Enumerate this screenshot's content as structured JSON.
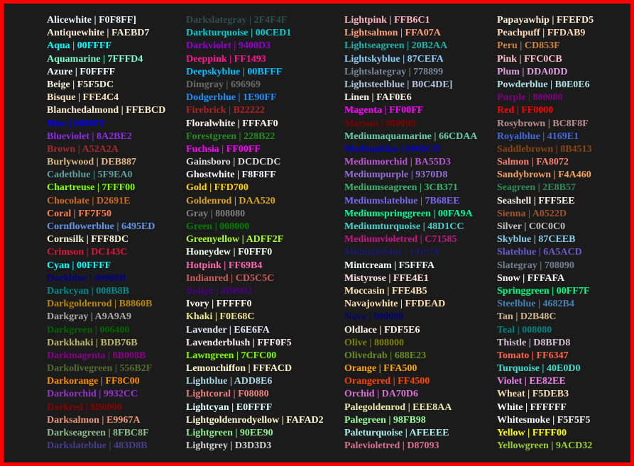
{
  "columns": [
    [
      {
        "label": "Alicewhite | F0F8FF]",
        "color": "#F0F8FF"
      },
      {
        "label": "Antiquewhite | FAEBD7",
        "color": "#FAEBD7"
      },
      {
        "label": "Aqua | 00FFFF",
        "color": "#00FFFF",
        "bold": true
      },
      {
        "label": "Aquamarine | 7FFFD4",
        "color": "#7FFFD4"
      },
      {
        "label": "Azure | F0FFFF",
        "color": "#F0FFFF"
      },
      {
        "label": "Beige | F5F5DC",
        "color": "#F5F5DC"
      },
      {
        "label": "Bisque | FFE4C4",
        "color": "#FFE4C4"
      },
      {
        "label": "Blanchedalmond | FFEBCD",
        "color": "#FFEBCD"
      },
      {
        "label": "Blue | 0000FF",
        "color": "#0000FF",
        "bold": true
      },
      {
        "label": "Blueviolet | 8A2BE2",
        "color": "#8A2BE2"
      },
      {
        "label": "Brown | A52A2A",
        "color": "#A52A2A"
      },
      {
        "label": "Burlywood | DEB887",
        "color": "#DEB887"
      },
      {
        "label": "Cadetblue | 5F9EA0",
        "color": "#5F9EA0"
      },
      {
        "label": "Chartreuse | 7FFF00",
        "color": "#7FFF00"
      },
      {
        "label": "Chocolate | D2691E",
        "color": "#D2691E"
      },
      {
        "label": "Coral | FF7F50",
        "color": "#FF7F50"
      },
      {
        "label": "Cornflowerblue | 6495ED",
        "color": "#6495ED"
      },
      {
        "label": "Cornsilk | FFF8DC",
        "color": "#FFF8DC"
      },
      {
        "label": "Crimson | DC143C",
        "color": "#DC143C"
      },
      {
        "label": "Cyan | 00FFFF",
        "color": "#00FFFF",
        "bold": true
      },
      {
        "label": "Darkblue | 00008B",
        "color": "#00008B"
      },
      {
        "label": "Darkcyan | 008B8B",
        "color": "#008B8B"
      },
      {
        "label": "Darkgoldenrod | B8860B",
        "color": "#B8860B"
      },
      {
        "label": "Darkgray | A9A9A9",
        "color": "#A9A9A9"
      },
      {
        "label": "Darkgreen | 006400",
        "color": "#006400"
      },
      {
        "label": "Darkkhaki | BDB76B",
        "color": "#BDB76B"
      },
      {
        "label": "Darkmagenta | 8B008B",
        "color": "#8B008B"
      },
      {
        "label": "Darkolivegreen | 556B2F",
        "color": "#556B2F"
      },
      {
        "label": "Darkorange | FF8C00",
        "color": "#FF8C00"
      },
      {
        "label": "Darkorchid | 9932CC",
        "color": "#9932CC"
      },
      {
        "label": "Darkred | 8B0000",
        "color": "#8B0000"
      },
      {
        "label": "Darksalmon | E9967A",
        "color": "#E9967A"
      },
      {
        "label": "Darkseagreen | 8FBC8F",
        "color": "#8FBC8F"
      },
      {
        "label": "Darkslateblue | 483D8B",
        "color": "#483D8B"
      }
    ],
    [
      {
        "label": "Darkslategray | 2F4F4F",
        "color": "#2F4F4F"
      },
      {
        "label": "Darkturquoise | 00CED1",
        "color": "#00CED1"
      },
      {
        "label": "Darkviolet | 9400D3",
        "color": "#9400D3"
      },
      {
        "label": "Deeppink | FF1493",
        "color": "#FF1493"
      },
      {
        "label": "Deepskyblue | 00BFFF",
        "color": "#00BFFF"
      },
      {
        "label": "Dimgray | 696969",
        "color": "#696969"
      },
      {
        "label": "Dodgerblue | 1E90FF",
        "color": "#1E90FF"
      },
      {
        "label": "Firebrick | B22222",
        "color": "#B22222"
      },
      {
        "label": "Floralwhite | FFFAF0",
        "color": "#FFFAF0"
      },
      {
        "label": "Forestgreen | 228B22",
        "color": "#228B22"
      },
      {
        "label": "Fuchsia | FF00FF",
        "color": "#FF00FF",
        "bold": true
      },
      {
        "label": "Gainsboro | DCDCDC",
        "color": "#DCDCDC"
      },
      {
        "label": "Ghostwhite | F8F8FF",
        "color": "#F8F8FF"
      },
      {
        "label": "Gold | FFD700",
        "color": "#FFD700"
      },
      {
        "label": "Goldenrod | DAA520",
        "color": "#DAA520"
      },
      {
        "label": "Gray | 808080",
        "color": "#808080"
      },
      {
        "label": "Green | 008000",
        "color": "#008000"
      },
      {
        "label": "Greenyellow | ADFF2F",
        "color": "#ADFF2F"
      },
      {
        "label": "Honeydew | F0FFF0",
        "color": "#F0FFF0"
      },
      {
        "label": "Hotpink | FF69B4",
        "color": "#FF69B4"
      },
      {
        "label": "Indianred | CD5C5C",
        "color": "#CD5C5C"
      },
      {
        "label": "Indigo | 4B0082",
        "color": "#4B0082"
      },
      {
        "label": "Ivory | FFFFF0",
        "color": "#FFFFF0"
      },
      {
        "label": "Khaki | F0E68C",
        "color": "#F0E68C"
      },
      {
        "label": "Lavender | E6E6FA",
        "color": "#E6E6FA"
      },
      {
        "label": "Lavenderblush | FFF0F5",
        "color": "#FFF0F5"
      },
      {
        "label": "Lawngreen | 7CFC00",
        "color": "#7CFC00"
      },
      {
        "label": "Lemonchiffon | FFFACD",
        "color": "#FFFACD"
      },
      {
        "label": "Lightblue | ADD8E6",
        "color": "#ADD8E6"
      },
      {
        "label": "Lightcoral | F08080",
        "color": "#F08080"
      },
      {
        "label": "Lightcyan | E0FFFF",
        "color": "#E0FFFF"
      },
      {
        "label": "Lightgoldenrodyellow | FAFAD2",
        "color": "#FAFAD2"
      },
      {
        "label": "Lightgreen | 90EE90",
        "color": "#90EE90"
      },
      {
        "label": "Lightgrey | D3D3D3",
        "color": "#D3D3D3"
      }
    ],
    [
      {
        "label": "Lightpink | FFB6C1",
        "color": "#FFB6C1"
      },
      {
        "label": "Lightsalmon | FFA07A",
        "color": "#FFA07A"
      },
      {
        "label": "Lightseagreen | 20B2AA",
        "color": "#20B2AA"
      },
      {
        "label": "Lightskyblue | 87CEFA",
        "color": "#87CEFA"
      },
      {
        "label": "Lightslategray | 778899",
        "color": "#778899"
      },
      {
        "label": "Lightsteelblue | B0C4DE]",
        "color": "#B0C4DE"
      },
      {
        "label": "Linen | FAF0E6",
        "color": "#FAF0E6"
      },
      {
        "label": "Magenta | FF00FF",
        "color": "#FF00FF",
        "bold": true
      },
      {
        "label": "Maroon | 800000",
        "color": "#800000"
      },
      {
        "label": "Mediumaquamarine | 66CDAA",
        "color": "#66CDAA"
      },
      {
        "label": "Mediumblue | 0000CD",
        "color": "#0000CD"
      },
      {
        "label": "Mediumorchid | BA55D3",
        "color": "#BA55D3"
      },
      {
        "label": "Mediumpurple | 9370D8",
        "color": "#9370D8"
      },
      {
        "label": "Mediumseagreen | 3CB371",
        "color": "#3CB371"
      },
      {
        "label": "Mediumslateblue | 7B68EE",
        "color": "#7B68EE"
      },
      {
        "label": "Mediumspringgreen | 00FA9A",
        "color": "#00FA9A"
      },
      {
        "label": "Mediumturquoise | 48D1CC",
        "color": "#48D1CC"
      },
      {
        "label": "Mediumvioletred | C71585",
        "color": "#C71585"
      },
      {
        "label": "Midnightblue | 191970",
        "color": "#191970"
      },
      {
        "label": "Mintcream | F5FFFA",
        "color": "#F5FFFA"
      },
      {
        "label": "Mistyrose | FFE4E1",
        "color": "#FFE4E1"
      },
      {
        "label": "Moccasin | FFE4B5",
        "color": "#FFE4B5"
      },
      {
        "label": "Navajowhite | FFDEAD",
        "color": "#FFDEAD"
      },
      {
        "label": "Navy | 000080",
        "color": "#000080"
      },
      {
        "label": "Oldlace | FDF5E6",
        "color": "#FDF5E6"
      },
      {
        "label": "Olive | 808000",
        "color": "#808000"
      },
      {
        "label": "Olivedrab | 688E23",
        "color": "#688E23"
      },
      {
        "label": "Orange | FFA500",
        "color": "#FFA500",
        "bold": true
      },
      {
        "label": "Orangered | FF4500",
        "color": "#FF4500",
        "bold": true
      },
      {
        "label": "Orchid | DA70D6",
        "color": "#DA70D6"
      },
      {
        "label": "Palegoldenrod | EEE8AA",
        "color": "#EEE8AA"
      },
      {
        "label": "Palegreen | 98FB98",
        "color": "#98FB98"
      },
      {
        "label": "Paleturquoise | AFEEEE",
        "color": "#AFEEEE"
      },
      {
        "label": "Palevioletred | D87093",
        "color": "#D87093"
      }
    ],
    [
      {
        "label": "Papayawhip | FFEFD5",
        "color": "#FFEFD5"
      },
      {
        "label": "Peachpuff | FFDAB9",
        "color": "#FFDAB9"
      },
      {
        "label": "Peru | CD853F",
        "color": "#CD853F"
      },
      {
        "label": "Pink | FFC0CB",
        "color": "#FFC0CB"
      },
      {
        "label": "Plum | DDA0DD",
        "color": "#DDA0DD"
      },
      {
        "label": "Powderblue | B0E0E6",
        "color": "#B0E0E6"
      },
      {
        "label": "Purple | 800080",
        "color": "#800080"
      },
      {
        "label": "Red | FF0000",
        "color": "#FF0000",
        "bold": true
      },
      {
        "label": "Rosybrown | BC8F8F",
        "color": "#BC8F8F"
      },
      {
        "label": "Royalblue | 4169E1",
        "color": "#4169E1"
      },
      {
        "label": "Saddlebrown | 8B4513",
        "color": "#8B4513"
      },
      {
        "label": "Salmon | FA8072",
        "color": "#FA8072"
      },
      {
        "label": "Sandybrown | F4A460",
        "color": "#F4A460"
      },
      {
        "label": "Seagreen | 2E8B57",
        "color": "#2E8B57"
      },
      {
        "label": "Seashell | FFF5EE",
        "color": "#FFF5EE"
      },
      {
        "label": "Sienna | A0522D",
        "color": "#A0522D"
      },
      {
        "label": "Silver | C0C0C0",
        "color": "#C0C0C0"
      },
      {
        "label": "Skyblue | 87CEEB",
        "color": "#87CEEB"
      },
      {
        "label": "Slateblue | 6A5ACD",
        "color": "#6A5ACD"
      },
      {
        "label": "Slategray | 708090",
        "color": "#708090"
      },
      {
        "label": "Snow | FFFAFA",
        "color": "#FFFAFA"
      },
      {
        "label": "Springgreen | 00FF7F",
        "color": "#00FF7F"
      },
      {
        "label": "Steelblue | 4682B4",
        "color": "#4682B4"
      },
      {
        "label": "Tan | D2B48C",
        "color": "#D2B48C"
      },
      {
        "label": "Teal | 008080",
        "color": "#008080"
      },
      {
        "label": "Thistle | D8BFD8",
        "color": "#D8BFD8"
      },
      {
        "label": "Tomato | FF6347",
        "color": "#FF6347"
      },
      {
        "label": "Turquoise | 40E0D0",
        "color": "#40E0D0"
      },
      {
        "label": "Violet | EE82EE",
        "color": "#EE82EE"
      },
      {
        "label": "Wheat | F5DEB3",
        "color": "#F5DEB3"
      },
      {
        "label": "White | FFFFFF",
        "color": "#FFFFFF"
      },
      {
        "label": "Whitesmoke | F5F5F5",
        "color": "#F5F5F5"
      },
      {
        "label": "Yellow | FFFF00",
        "color": "#FFFF00",
        "bold": true
      },
      {
        "label": "Yellowgreen | 9ACD32",
        "color": "#9ACD32"
      }
    ]
  ]
}
